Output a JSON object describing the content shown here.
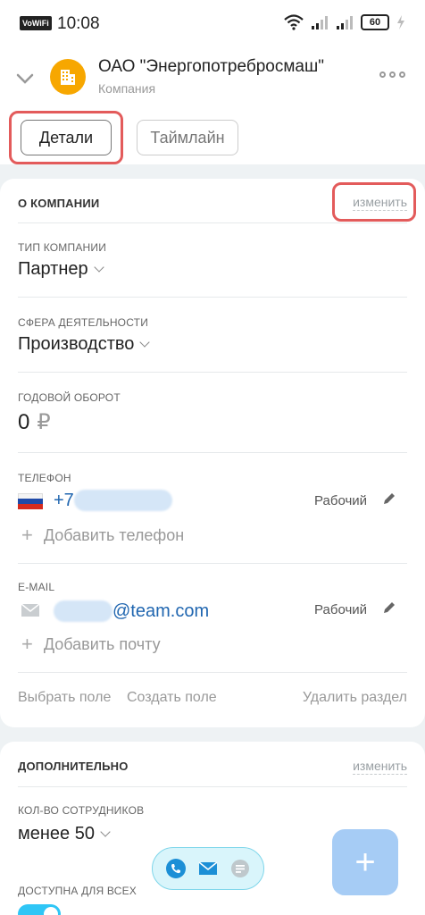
{
  "status_bar": {
    "vowifi": "VoWiFi",
    "time": "10:08",
    "battery": "60"
  },
  "header": {
    "title": "ОАО \"Энергопотребросмаш\"",
    "subtitle": "Компания"
  },
  "tabs": [
    {
      "label": "Детали",
      "active": true
    },
    {
      "label": "Таймлайн",
      "active": false
    }
  ],
  "about": {
    "heading": "О КОМПАНИИ",
    "edit_label": "изменить",
    "company_type": {
      "label": "ТИП КОМПАНИИ",
      "value": "Партнер"
    },
    "industry": {
      "label": "СФЕРА ДЕЯТЕЛЬНОСТИ",
      "value": "Производство"
    },
    "revenue": {
      "label": "ГОДОВОЙ ОБОРОТ",
      "value": "0",
      "currency": "₽"
    },
    "phone": {
      "label": "ТЕЛЕФОН",
      "value": "+7",
      "type": "Рабочий",
      "add_label": "Добавить телефон"
    },
    "email": {
      "label": "E-MAIL",
      "value": "@team.com",
      "type": "Рабочий",
      "add_label": "Добавить почту"
    },
    "footer": {
      "select_field": "Выбрать поле",
      "create_field": "Создать поле",
      "delete_section": "Удалить раздел"
    }
  },
  "additional": {
    "heading": "ДОПОЛНИТЕЛЬНО",
    "edit_label": "изменить",
    "employees": {
      "label": "КОЛ-ВО СОТРУДНИКОВ",
      "value": "менее 50"
    },
    "available": {
      "label": "ДОСТУПНА ДЛЯ ВСЕХ",
      "enabled": true
    }
  },
  "colors": {
    "accent": "#2fc6f6",
    "highlight": "#e35b5b",
    "link": "#2066b0",
    "fab": "#a6ccf5"
  }
}
